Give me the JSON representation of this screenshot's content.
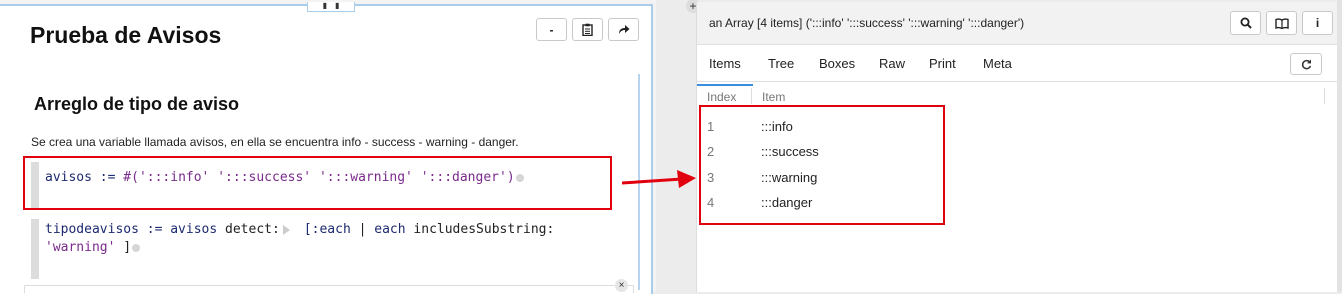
{
  "left_panel": {
    "title": "Prueba de Avisos",
    "toolbar": {
      "minimize_label": "-",
      "clipboard_icon": "clipboard-icon",
      "share_icon": "share-arrow-icon"
    },
    "section_heading": "Arreglo de tipo de aviso",
    "description": "Se crea una variable llamada avisos, en ella se encuentra  info - success - warning -  danger.",
    "code1": {
      "var": "avisos",
      "assign": ":=",
      "literal_open": "#(",
      "s1": "':::info'",
      "s2": "':::success'",
      "s3": "':::warning'",
      "s4": "':::danger'",
      "literal_close": ")"
    },
    "code2": {
      "var": "tipodeavisos",
      "assign": ":=",
      "receiver": "avisos",
      "selector": "detect:",
      "block_open": "[:each",
      "bar": "|",
      "arg": "each",
      "message": "includesSubstring:",
      "string": "'warning'",
      "block_close": "]"
    },
    "close_glyph": "×"
  },
  "add_glyph": "+",
  "inspector": {
    "title": "an Array [4 items] (':::info' ':::success' ':::warning' ':::danger')",
    "buttons": {
      "search_icon": "search-icon",
      "book_icon": "book-icon",
      "info_label": "i"
    },
    "tabs": [
      "Items",
      "Tree",
      "Boxes",
      "Raw",
      "Print",
      "Meta"
    ],
    "active_tab": "Items",
    "refresh_icon": "refresh-icon",
    "columns": {
      "index": "Index",
      "item": "Item"
    },
    "rows": [
      {
        "index": "1",
        "item": ":::info"
      },
      {
        "index": "2",
        "item": ":::success"
      },
      {
        "index": "3",
        "item": ":::warning"
      },
      {
        "index": "4",
        "item": ":::danger"
      }
    ]
  },
  "colors": {
    "highlight": "#e0000e",
    "accent": "#3b8de0"
  }
}
